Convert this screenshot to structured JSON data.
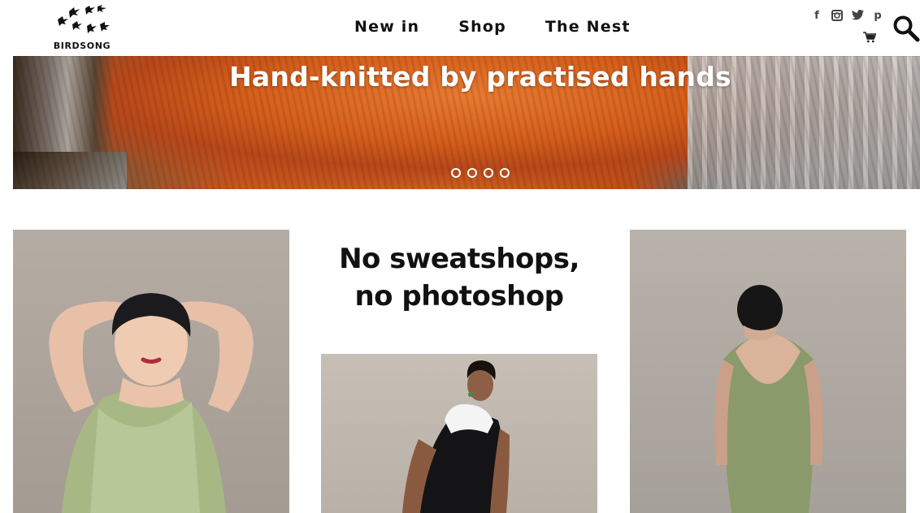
{
  "brand": {
    "name": "BIRDSONG"
  },
  "nav": {
    "items": [
      "New in",
      "Shop",
      "The Nest"
    ]
  },
  "social": {
    "facebook": "f",
    "instagram": "instagram-icon",
    "twitter": "twitter-icon",
    "pinterest": "p"
  },
  "hero": {
    "title": "Hand-knitted by practised hands",
    "slides": 4,
    "active_slide": 1
  },
  "tagline": {
    "line1": "No sweatshops,",
    "line2": "no photoshop"
  },
  "colors": {
    "text": "#111111",
    "background": "#ffffff",
    "hero_orange": "#d96a26"
  }
}
